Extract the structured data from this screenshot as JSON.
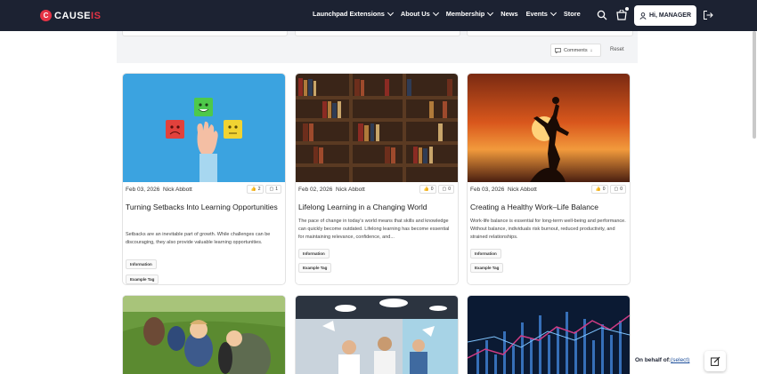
{
  "header": {
    "brand_prefix": "CAUSE",
    "brand_suffix": "IS",
    "nav": [
      {
        "label": "Launchpad Extensions",
        "dropdown": true
      },
      {
        "label": "About Us",
        "dropdown": true
      },
      {
        "label": "Membership",
        "dropdown": true
      },
      {
        "label": "News",
        "dropdown": false
      },
      {
        "label": "Events",
        "dropdown": true
      },
      {
        "label": "Store",
        "dropdown": false
      }
    ],
    "user_button": "Hi, MANAGER"
  },
  "filters": {
    "sort_label": "Comments",
    "sort_arrow": "↓",
    "reset": "Reset"
  },
  "cards": [
    {
      "date": "Feb 03, 2026",
      "author": "Nick Abbott",
      "likes": "2",
      "comments": "1",
      "title": "Turning Setbacks Into Learning Opportunities",
      "excerpt": "Setbacks are an inevitable part of growth. While challenges can be discouraging, they also provide valuable learning opportunities.",
      "tags": [
        "Information",
        "Example Tag"
      ]
    },
    {
      "date": "Feb 02, 2026",
      "author": "Nick Abbott",
      "likes": "0",
      "comments": "0",
      "title": "Lifelong Learning in a Changing World",
      "excerpt": "The pace of change in today's world means that skills and knowledge can quickly become outdated. Lifelong learning has become essential for maintaining relevance, confidence, and...",
      "tags": [
        "Information",
        "Example Tag"
      ]
    },
    {
      "date": "Feb 03, 2026",
      "author": "Nick Abbott",
      "likes": "0",
      "comments": "0",
      "title": "Creating a Healthy Work–Life Balance",
      "excerpt": "Work-life balance is essential for long-term well-being and performance. Without balance, individuals risk burnout, reduced productivity, and strained relationships.",
      "tags": [
        "Information",
        "Example Tag"
      ]
    }
  ],
  "footer": {
    "behalf_label": "On behalf of:",
    "behalf_link": "(select)"
  }
}
